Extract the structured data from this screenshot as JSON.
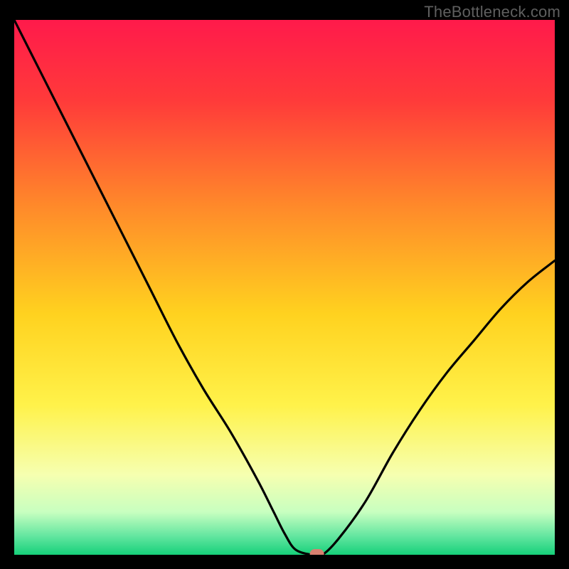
{
  "watermark": "TheBottleneck.com",
  "chart_data": {
    "type": "line",
    "title": "",
    "xlabel": "",
    "ylabel": "",
    "xlim": [
      0,
      100
    ],
    "ylim": [
      0,
      100
    ],
    "series": [
      {
        "name": "bottleneck-curve",
        "x": [
          0,
          5,
          10,
          15,
          20,
          25,
          30,
          35,
          40,
          45,
          48,
          50,
          52,
          55,
          57,
          60,
          65,
          70,
          75,
          80,
          85,
          90,
          95,
          100
        ],
        "y": [
          100,
          90,
          80,
          70,
          60,
          50,
          40,
          31,
          23,
          14,
          8,
          4,
          1,
          0,
          0,
          3,
          10,
          19,
          27,
          34,
          40,
          46,
          51,
          55
        ]
      }
    ],
    "marker": {
      "x": 56,
      "y": 0,
      "color": "#d88070"
    },
    "gradient_stops": [
      {
        "offset": 0.0,
        "color": "#ff1a4b"
      },
      {
        "offset": 0.15,
        "color": "#ff3a3a"
      },
      {
        "offset": 0.35,
        "color": "#ff8a2a"
      },
      {
        "offset": 0.55,
        "color": "#ffd21f"
      },
      {
        "offset": 0.72,
        "color": "#fff24a"
      },
      {
        "offset": 0.85,
        "color": "#f6ffb0"
      },
      {
        "offset": 0.92,
        "color": "#c8ffc0"
      },
      {
        "offset": 0.965,
        "color": "#63e6a0"
      },
      {
        "offset": 1.0,
        "color": "#16d07a"
      }
    ]
  }
}
